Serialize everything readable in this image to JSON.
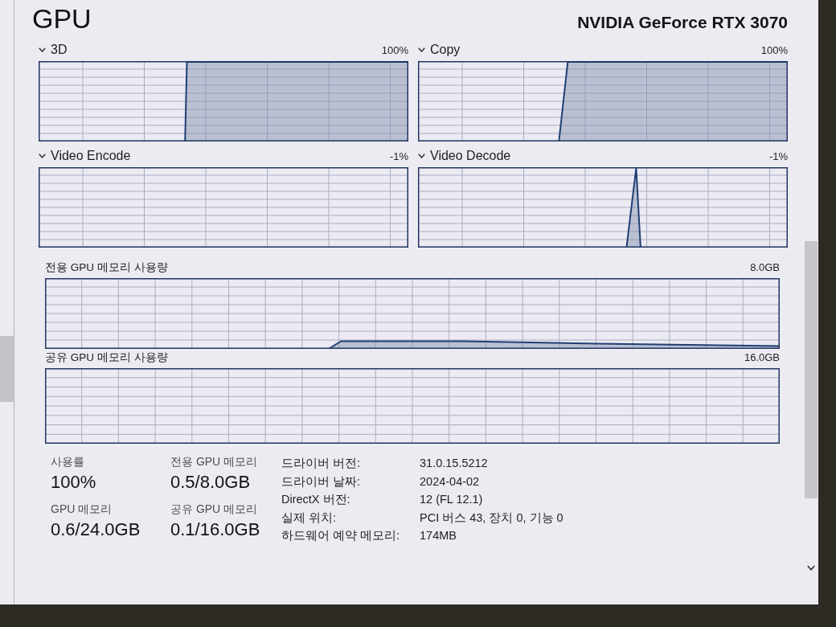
{
  "header": {
    "title": "GPU",
    "device_name": "NVIDIA GeForce RTX 3070"
  },
  "engine_graphs": [
    {
      "label": "3D",
      "reading": "100%"
    },
    {
      "label": "Copy",
      "reading": "100%"
    },
    {
      "label": "Video Encode",
      "reading": "-1%"
    },
    {
      "label": "Video Decode",
      "reading": "-1%"
    }
  ],
  "memory_graphs": [
    {
      "label": "전용 GPU 메모리 사용량",
      "reading": "8.0GB"
    },
    {
      "label": "공유 GPU 메모리 사용량",
      "reading": "16.0GB"
    }
  ],
  "stats": [
    {
      "label": "사용률",
      "value": "100%"
    },
    {
      "label": "전용 GPU 메모리",
      "value": "0.5/8.0GB"
    },
    {
      "label": "GPU 메모리",
      "value": "0.6/24.0GB"
    },
    {
      "label": "공유 GPU 메모리",
      "value": "0.1/16.0GB"
    }
  ],
  "properties": [
    {
      "label": "드라이버 버전:",
      "value": "31.0.15.5212"
    },
    {
      "label": "드라이버 날짜:",
      "value": "2024-04-02"
    },
    {
      "label": "DirectX 버전:",
      "value": "12 (FL 12.1)"
    },
    {
      "label": "실제 위치:",
      "value": "PCI 버스 43, 장치 0, 기능 0"
    },
    {
      "label": "하드웨어 예약 메모리:",
      "value": "174MB"
    }
  ]
}
